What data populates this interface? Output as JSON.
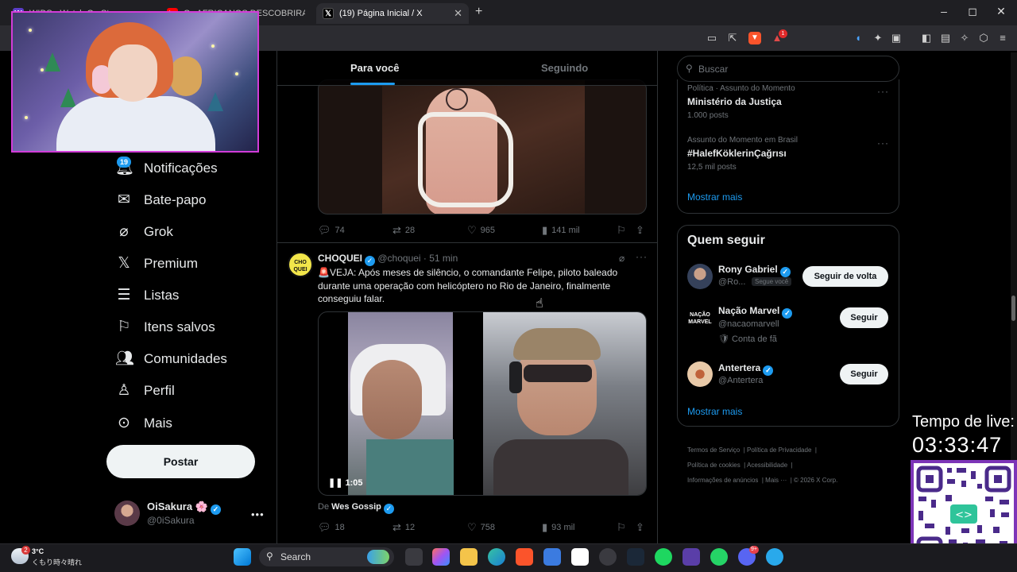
{
  "browser": {
    "tabs": [
      {
        "label": "WIDS - Watch On Stream",
        "favicon_color": "#5b3ec8"
      },
      {
        "label": "Os AFRICANOS DESCOBRIRAM A Am",
        "favicon_color": "#ff0000"
      },
      {
        "label": "(19) Página Inicial / X",
        "favicon_color": "#000000",
        "active": true
      }
    ],
    "new_tab": "+",
    "window_controls": [
      "–",
      "◻",
      "✕"
    ],
    "brave_badge": "1"
  },
  "nav": {
    "notifications_badge": "19",
    "items": [
      {
        "label": "Notificações",
        "icon": "bell-icon"
      },
      {
        "label": "Bate-papo",
        "icon": "envelope-icon"
      },
      {
        "label": "Grok",
        "icon": "grok-icon"
      },
      {
        "label": "Premium",
        "icon": "x-logo-icon"
      },
      {
        "label": "Listas",
        "icon": "list-icon"
      },
      {
        "label": "Itens salvos",
        "icon": "bookmark-icon"
      },
      {
        "label": "Comunidades",
        "icon": "people-icon"
      },
      {
        "label": "Perfil",
        "icon": "person-icon"
      },
      {
        "label": "Mais",
        "icon": "more-circle-icon"
      }
    ],
    "post_button": "Postar",
    "profile": {
      "name": "OiSakura 🌸",
      "handle": "@0iSakura"
    }
  },
  "timeline": {
    "tabs": [
      {
        "label": "Para você",
        "active": true
      },
      {
        "label": "Seguindo",
        "active": false
      }
    ],
    "tweet1": {
      "actions": {
        "replies": "74",
        "reposts": "28",
        "likes": "965",
        "views": "141 mil"
      }
    },
    "tweet2": {
      "author": "CHOQUEI",
      "handle": "@choquei",
      "time": "· 51 min",
      "avatar_text": "CHO QUEI",
      "text": "🚨VEJA: Após meses de silêncio, o comandante Felipe, piloto baleado durante uma operação com helicóptero no Rio de Janeiro, finalmente conseguiu falar.",
      "video_duration": "1:05",
      "source_prefix": "De",
      "source_name": "Wes Gossip",
      "actions": {
        "replies": "18",
        "reposts": "12",
        "likes": "758",
        "views": "93 mil"
      }
    }
  },
  "sidebar": {
    "search_placeholder": "Buscar",
    "trends": [
      {
        "meta": "Política · Assunto do Momento",
        "title": "Ministério da Justiça",
        "count": "1.000 posts"
      },
      {
        "meta": "Assunto do Momento em Brasil",
        "title": "#HalefKöklerinÇağrısı",
        "count": "12,5 mil posts"
      }
    ],
    "trends_more": "Mostrar mais",
    "who_to_follow": {
      "title": "Quem seguir",
      "users": [
        {
          "name": "Rony Gabriel",
          "handle": "@Ro...",
          "tag": "Segue você",
          "button": "Seguir de volta"
        },
        {
          "name": "Nação Marvel",
          "handle": "@nacaomarvell",
          "extra": "🛡 Conta de fã",
          "button": "Seguir",
          "avatar_text": "NAÇÃO MARVEL"
        },
        {
          "name": "Antertera",
          "handle": "@Antertera",
          "button": "Seguir"
        }
      ],
      "more": "Mostrar mais"
    },
    "footer": {
      "row1": [
        "Termos de Serviço",
        "Política de Privacidade"
      ],
      "row2": [
        "Política de cookies",
        "Acessibilidade"
      ],
      "row3": [
        "Informações de anúncios",
        "Mais ···",
        "© 2026 X Corp."
      ]
    }
  },
  "stream": {
    "timer_label": "Tempo de live:",
    "timer_value": "03:33:47"
  },
  "taskbar": {
    "weather_temp": "3°C",
    "weather_text": "くもり時々晴れ",
    "weather_badge": "2",
    "search_label": "Search",
    "discord_badge": "9+"
  }
}
